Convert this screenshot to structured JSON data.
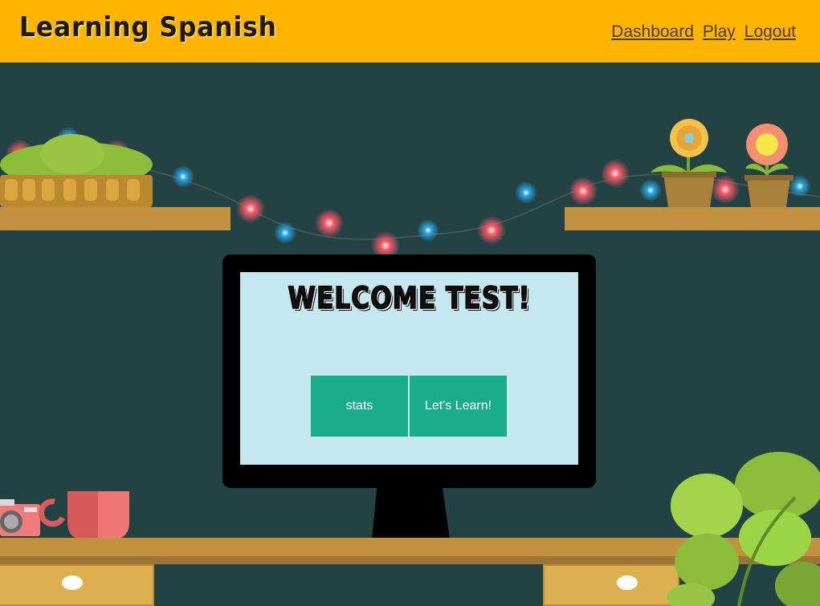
{
  "header": {
    "brand": "Learning Spanish",
    "nav": [
      {
        "label": "Dashboard"
      },
      {
        "label": "Play"
      },
      {
        "label": "Logout"
      }
    ]
  },
  "screen": {
    "welcome": "WELCOME TEST!",
    "buttons": {
      "stats": "stats",
      "learn": "Let's Learn!"
    }
  },
  "colors": {
    "header_bg": "#ffb400",
    "wall_bg": "#234244",
    "button_bg": "#1aad8a",
    "screen_bg": "#c5e7f0"
  }
}
